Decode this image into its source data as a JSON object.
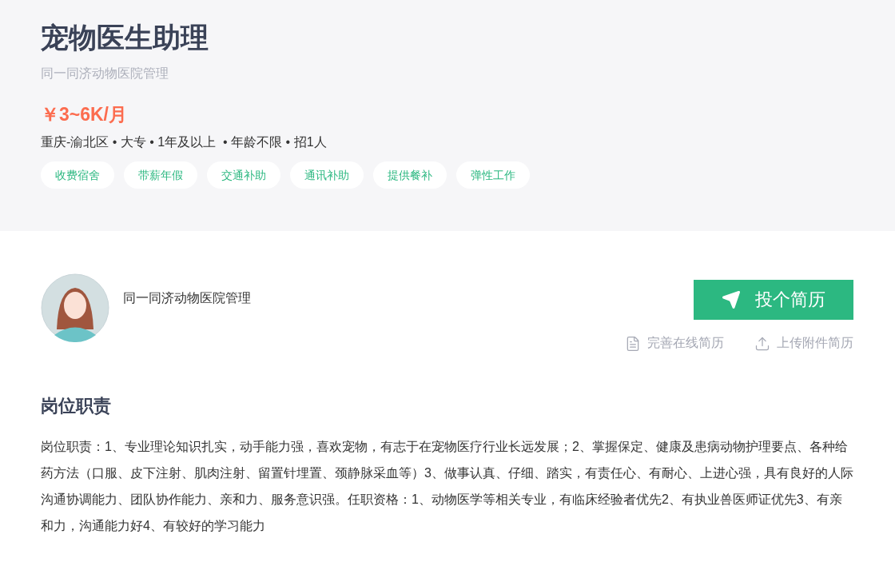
{
  "job": {
    "title": "宠物医生助理",
    "company": "同一同济动物医院管理",
    "salary": "￥3~6K/月",
    "meta": "重庆-渝北区 • 大专 • 1年及以上  • 年龄不限 • 招1人",
    "tags": [
      "收费宿舍",
      "带薪年假",
      "交通补助",
      "通讯补助",
      "提供餐补",
      "弹性工作"
    ]
  },
  "employer": {
    "name": "同一同济动物医院管理"
  },
  "actions": {
    "apply": "投个简历",
    "links": [
      {
        "kind": "online",
        "label": "完善在线简历"
      },
      {
        "kind": "upload",
        "label": "上传附件简历"
      }
    ]
  },
  "section": {
    "heading": "岗位职责",
    "body": "岗位职责：1、专业理论知识扎实，动手能力强，喜欢宠物，有志于在宠物医疗行业长远发展；2、掌握保定、健康及患病动物护理要点、各种给药方法（口服、皮下注射、肌肉注射、留置针埋置、颈静脉采血等）3、做事认真、仔细、踏实，有责任心、有耐心、上进心强，具有良好的人际沟通协调能力、团队协作能力、亲和力、服务意识强。任职资格：1、动物医学等相关专业，有临床经验者优先2、有执业兽医师证优先3、有亲和力，沟通能力好4、有较好的学习能力"
  }
}
